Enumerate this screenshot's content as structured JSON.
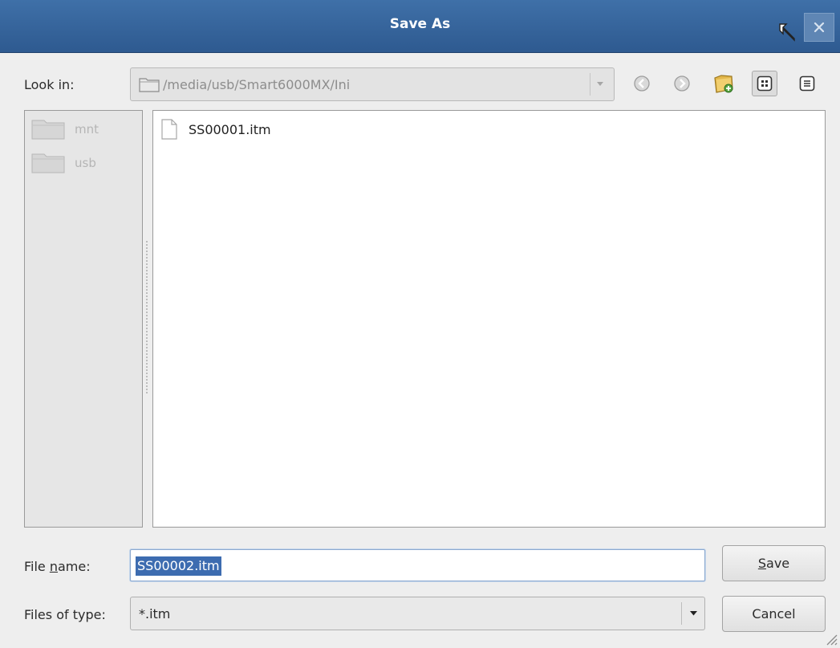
{
  "window": {
    "title": "Save As"
  },
  "look_in": {
    "label": "Look in:",
    "path": "/media/usb/Smart6000MX/Ini"
  },
  "toolbar": {
    "buttons": [
      {
        "name": "back-icon"
      },
      {
        "name": "forward-icon"
      },
      {
        "name": "new-folder-icon"
      },
      {
        "name": "icon-view-icon",
        "active": true
      },
      {
        "name": "detail-view-icon"
      }
    ]
  },
  "sidebar": {
    "items": [
      {
        "label": "mnt"
      },
      {
        "label": "usb"
      }
    ]
  },
  "files": [
    {
      "label": "SS00001.itm"
    }
  ],
  "file_name": {
    "label_pre": "File ",
    "label_underline": "n",
    "label_post": "ame:",
    "value": "SS00002.itm"
  },
  "file_type": {
    "label": "Files of type:",
    "value": "*.itm"
  },
  "buttons": {
    "save_underline": "S",
    "save_rest": "ave",
    "cancel": "Cancel"
  },
  "colors": {
    "titlebar": "#2e5a90",
    "selection": "#3d6cb0"
  }
}
